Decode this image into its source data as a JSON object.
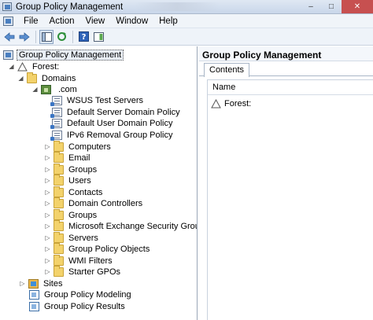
{
  "window": {
    "title": "Group Policy Management",
    "buttons": {
      "minimize": "–",
      "maximize": "□",
      "close": "✕"
    }
  },
  "menu": [
    "File",
    "Action",
    "View",
    "Window",
    "Help"
  ],
  "toolbar": {
    "icons": [
      "back-arrow-icon",
      "forward-arrow-icon",
      "show-hide-tree-icon",
      "refresh-icon",
      "help-icon",
      "properties-icon"
    ]
  },
  "tree": {
    "root": "Group Policy Management",
    "forest": "Forest:",
    "domains": "Domains",
    "domain": ".com",
    "domain_items": [
      "WSUS Test Servers",
      "Default Server Domain Policy",
      "Default User Domain Policy",
      "IPv6 Removal Group Policy",
      "Computers",
      "Email",
      "Groups",
      "Users",
      "Contacts",
      "Domain Controllers",
      "Groups",
      "Microsoft Exchange Security Groups",
      "Servers",
      "Group Policy Objects",
      "WMI Filters",
      "Starter GPOs"
    ],
    "sites": "Sites",
    "modeling": "Group Policy Modeling",
    "results": "Group Policy Results"
  },
  "right": {
    "title": "Group Policy Management",
    "tab": "Contents",
    "column": "Name",
    "rows": [
      "Forest:"
    ]
  },
  "colors": {
    "titlebar": "#c9d7ea",
    "folder": "#f3d26b",
    "close": "#c75050"
  }
}
